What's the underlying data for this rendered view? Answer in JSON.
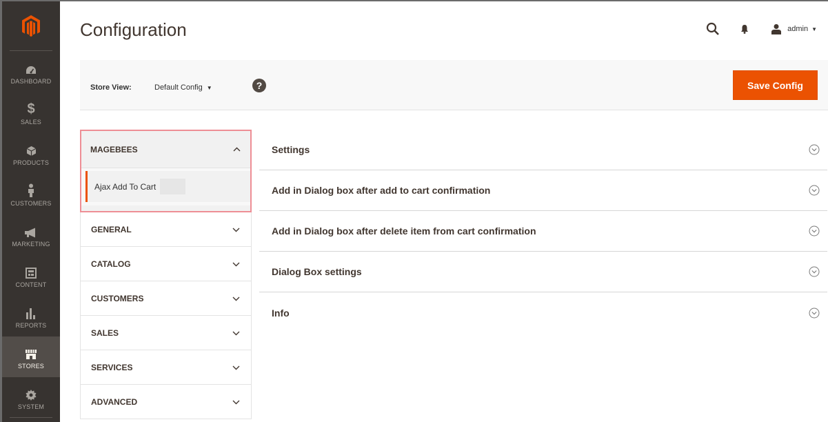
{
  "nav": {
    "items": [
      {
        "label": "Dashboard",
        "icon": "dashboard-icon"
      },
      {
        "label": "Sales",
        "icon": "dollar-icon"
      },
      {
        "label": "Products",
        "icon": "cube-icon"
      },
      {
        "label": "Customers",
        "icon": "person-icon"
      },
      {
        "label": "Marketing",
        "icon": "megaphone-icon"
      },
      {
        "label": "Content",
        "icon": "content-icon"
      },
      {
        "label": "Reports",
        "icon": "bar-chart-icon"
      },
      {
        "label": "Stores",
        "icon": "store-icon",
        "active": true
      },
      {
        "label": "System",
        "icon": "gear-icon"
      }
    ]
  },
  "header": {
    "title": "Configuration",
    "user": "admin"
  },
  "store_bar": {
    "label": "Store View:",
    "selected": "Default Config",
    "help": "?",
    "save_label": "Save Config"
  },
  "tabs": {
    "mageebees": {
      "label": "MAGEBEES",
      "sub_item": "Ajax Add To Cart"
    },
    "groups": [
      {
        "label": "GENERAL"
      },
      {
        "label": "CATALOG"
      },
      {
        "label": "CUSTOMERS"
      },
      {
        "label": "SALES"
      },
      {
        "label": "SERVICES"
      },
      {
        "label": "ADVANCED"
      }
    ]
  },
  "sections": [
    {
      "title": "Settings"
    },
    {
      "title": "Add in Dialog box after add to cart confirmation"
    },
    {
      "title": "Add in Dialog box after delete item from cart confirmation"
    },
    {
      "title": "Dialog Box settings"
    },
    {
      "title": "Info"
    }
  ],
  "colors": {
    "nav_bg": "#373330",
    "accent": "#eb5202",
    "highlight_border": "#ee8e95"
  }
}
